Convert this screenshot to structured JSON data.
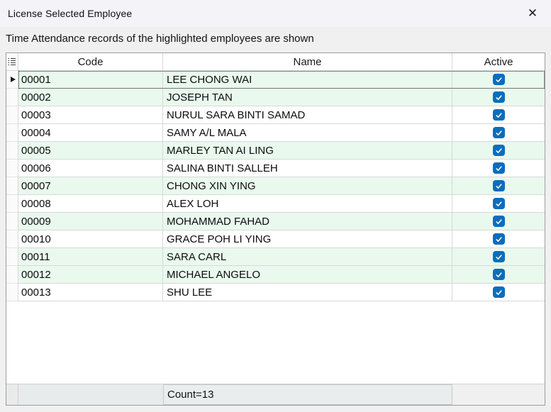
{
  "window": {
    "title": "License Selected Employee",
    "close_glyph": "✕"
  },
  "subtitle": "Time Attendance records of the highlighted employees are shown",
  "grid": {
    "columns": [
      {
        "key": "code",
        "label": "Code"
      },
      {
        "key": "name",
        "label": "Name"
      },
      {
        "key": "active",
        "label": "Active"
      }
    ],
    "rows": [
      {
        "code": "00001",
        "name": "LEE CHONG WAI",
        "active": true,
        "highlighted": true,
        "focused": true
      },
      {
        "code": "00002",
        "name": "JOSEPH TAN",
        "active": true,
        "highlighted": true,
        "focused": false
      },
      {
        "code": "00003",
        "name": "NURUL SARA BINTI SAMAD",
        "active": true,
        "highlighted": false,
        "focused": false
      },
      {
        "code": "00004",
        "name": "SAMY A/L MALA",
        "active": true,
        "highlighted": false,
        "focused": false
      },
      {
        "code": "00005",
        "name": "MARLEY TAN AI LING",
        "active": true,
        "highlighted": true,
        "focused": false
      },
      {
        "code": "00006",
        "name": "SALINA BINTI SALLEH",
        "active": true,
        "highlighted": false,
        "focused": false
      },
      {
        "code": "00007",
        "name": "CHONG XIN YING",
        "active": true,
        "highlighted": true,
        "focused": false
      },
      {
        "code": "00008",
        "name": "ALEX LOH",
        "active": true,
        "highlighted": false,
        "focused": false
      },
      {
        "code": "00009",
        "name": "MOHAMMAD FAHAD",
        "active": true,
        "highlighted": true,
        "focused": false
      },
      {
        "code": "00010",
        "name": "GRACE POH LI YING",
        "active": true,
        "highlighted": false,
        "focused": false
      },
      {
        "code": "00011",
        "name": "SARA CARL",
        "active": true,
        "highlighted": true,
        "focused": false
      },
      {
        "code": "00012",
        "name": "MICHAEL ANGELO",
        "active": true,
        "highlighted": true,
        "focused": false
      },
      {
        "code": "00013",
        "name": "SHU LEE",
        "active": true,
        "highlighted": false,
        "focused": false
      }
    ],
    "footer": {
      "count_label": "Count=13"
    }
  },
  "icons": {
    "close": "close-icon",
    "column_chooser": "column-chooser-icon",
    "focused_row_marker": "focused-row-arrow-icon",
    "checkbox_check": "checkmark-icon"
  },
  "colors": {
    "highlight_row_green": "#e9f9ee",
    "checkbox_blue": "#0b6dbe",
    "grid_line": "#d8d8d8",
    "grid_border": "#9d9da4",
    "titlebar_bg": "#f3f3f8",
    "content_bg": "#f0f0f0",
    "footer_cell_bg": "#e9eded"
  }
}
